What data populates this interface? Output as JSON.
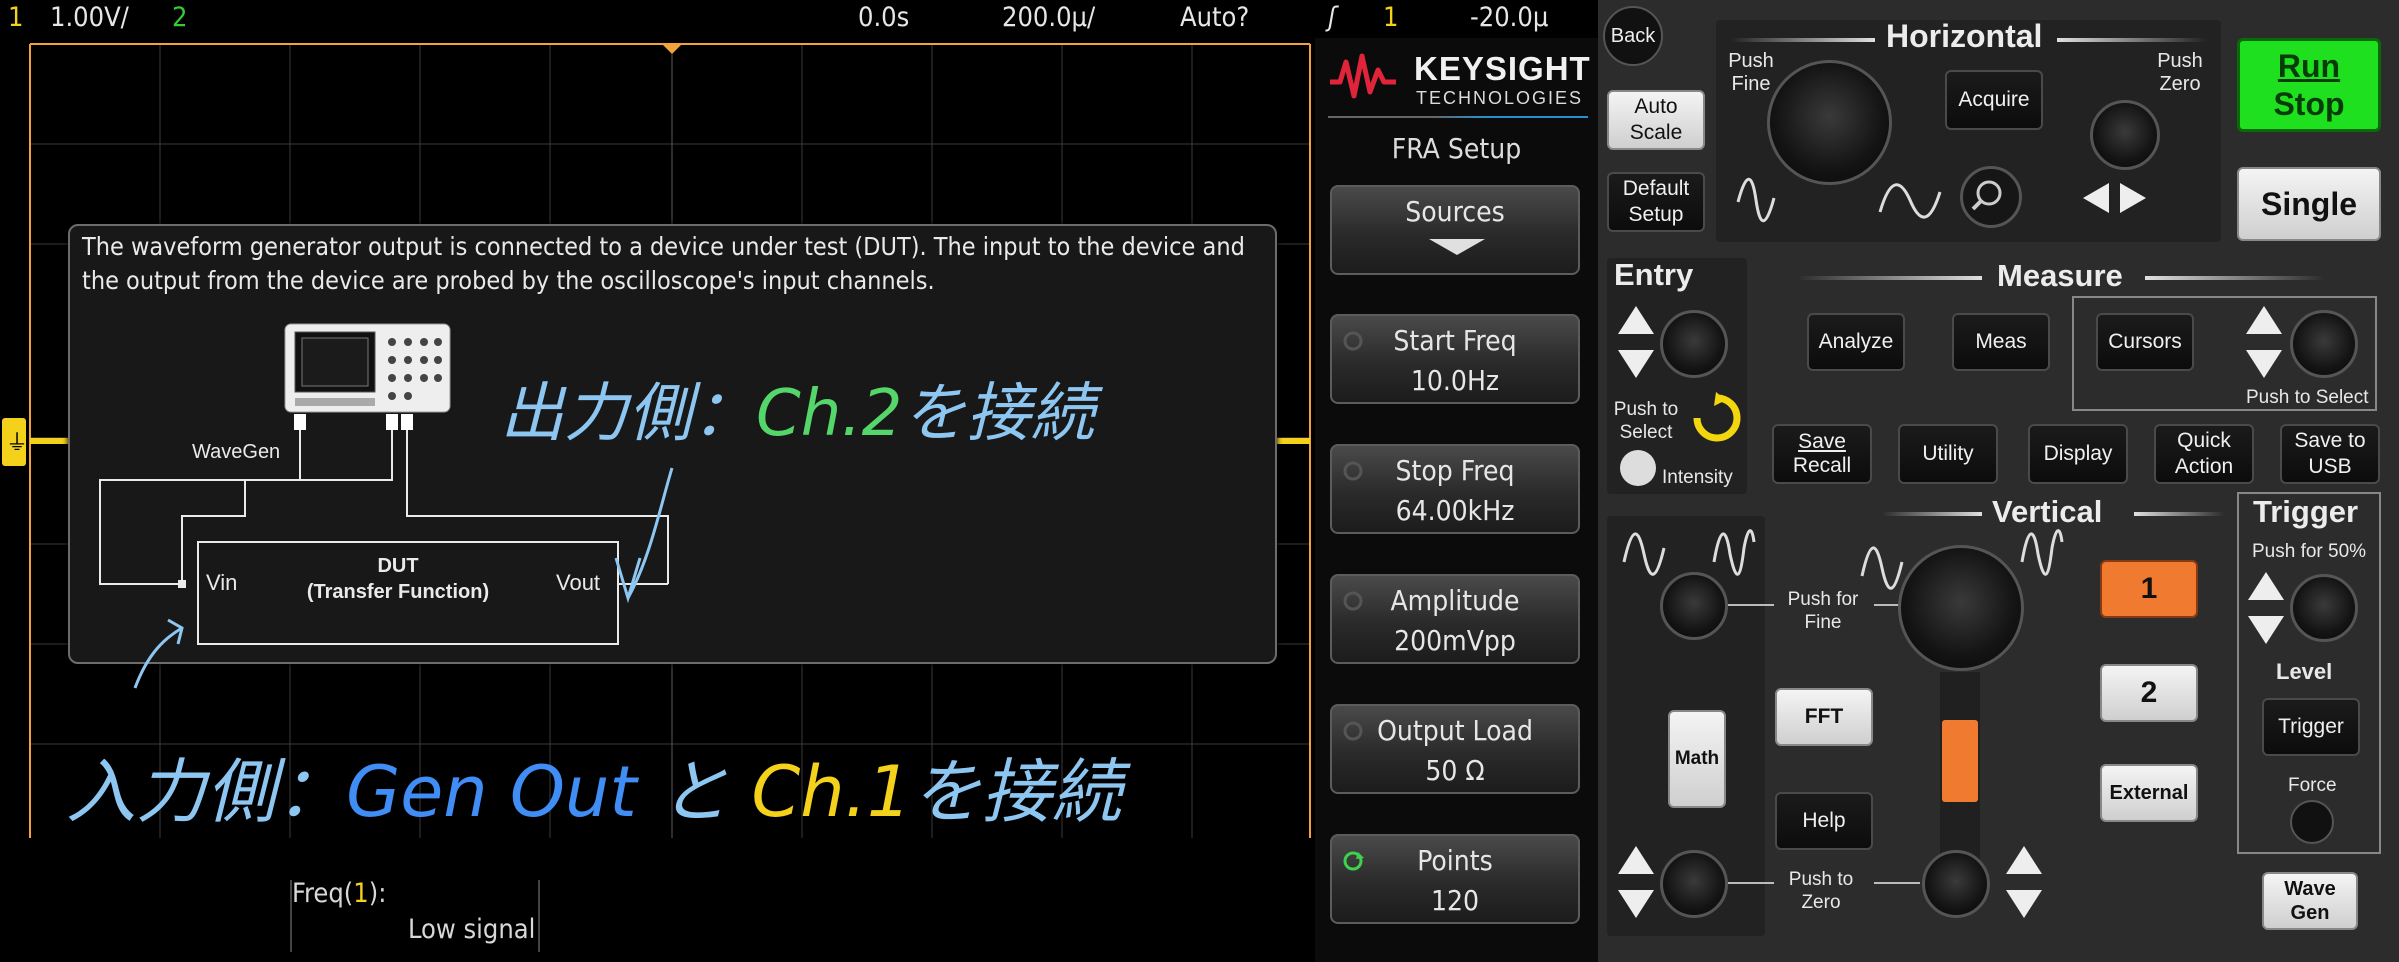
{
  "status_bar": {
    "ch1_number": "1",
    "ch1_scale": "1.00V/",
    "ch2_number": "2",
    "time_delay": "0.0s",
    "time_scale": "200.0µ/",
    "trigger_mode": "Auto?",
    "trigger_source": "1",
    "trigger_level": "-20.0µ"
  },
  "popup": {
    "description": "The waveform generator output is connected to a device under test (DUT). The input to the device and the output from the device are probed by the oscilloscope's input channels.",
    "wavegen_label": "WaveGen",
    "dut_title": "DUT",
    "dut_subtitle": "(Transfer Function)",
    "vin_label": "Vin",
    "vout_label": "Vout"
  },
  "annotations": {
    "output_side_prefix": "出力側：",
    "output_side_ch": "Ch.2",
    "output_side_suffix": "を接続",
    "input_side_prefix": "入力側：",
    "input_side_gen": "Gen Out",
    "input_side_to": "と",
    "input_side_ch": "Ch.1",
    "input_side_suffix": "を接続"
  },
  "measurement": {
    "label_prefix": "Freq(",
    "label_channel": "1",
    "label_suffix": "):",
    "value": "Low signal"
  },
  "softkeys": {
    "brand": "KEYSIGHT",
    "brand_sub": "TECHNOLOGIES",
    "menu_title": "FRA Setup",
    "items": [
      {
        "label": "Sources",
        "value": ""
      },
      {
        "label": "Start Freq",
        "value": "10.0Hz"
      },
      {
        "label": "Stop Freq",
        "value": "64.00kHz"
      },
      {
        "label": "Amplitude",
        "value": "200mVpp"
      },
      {
        "label": "Output Load",
        "value": "50 Ω"
      },
      {
        "label": "Points",
        "value": "120"
      }
    ]
  },
  "front_panel": {
    "back": "Back",
    "auto_scale": "Auto Scale",
    "default_setup": "Default Setup",
    "horizontal_title": "Horizontal",
    "push_fine": "Push Fine",
    "push_zero": "Push Zero",
    "acquire": "Acquire",
    "run_stop_1": "Run",
    "run_stop_2": "Stop",
    "single": "Single",
    "entry_title": "Entry",
    "push_to_select": "Push to Select",
    "intensity": "Intensity",
    "measure_title": "Measure",
    "analyze": "Analyze",
    "meas": "Meas",
    "cursors": "Cursors",
    "push_to_select_cursors": "Push to Select",
    "save_recall_1": "Save",
    "save_recall_2": "Recall",
    "utility": "Utility",
    "display": "Display",
    "quick_action": "Quick Action",
    "save_to_usb": "Save to USB",
    "vertical_title": "Vertical",
    "push_for_fine": "Push for Fine",
    "push_to_zero": "Push to Zero",
    "fft": "FFT",
    "math": "Math",
    "help": "Help",
    "ch1": "1",
    "ch2": "2",
    "external": "External",
    "trigger_title": "Trigger",
    "push_for_50": "Push for 50%",
    "level": "Level",
    "trigger_btn": "Trigger",
    "force": "Force",
    "wave_gen": "Wave Gen"
  },
  "colors": {
    "ch1": "#f4d21c",
    "ch2": "#33cc33",
    "ch1_button": "#f07a30",
    "run_stop": "#1ee01e",
    "handwriting_blue": "#8ec6f2",
    "handwriting_green": "#55d66a",
    "handwriting_dark_blue": "#3f8df5"
  }
}
